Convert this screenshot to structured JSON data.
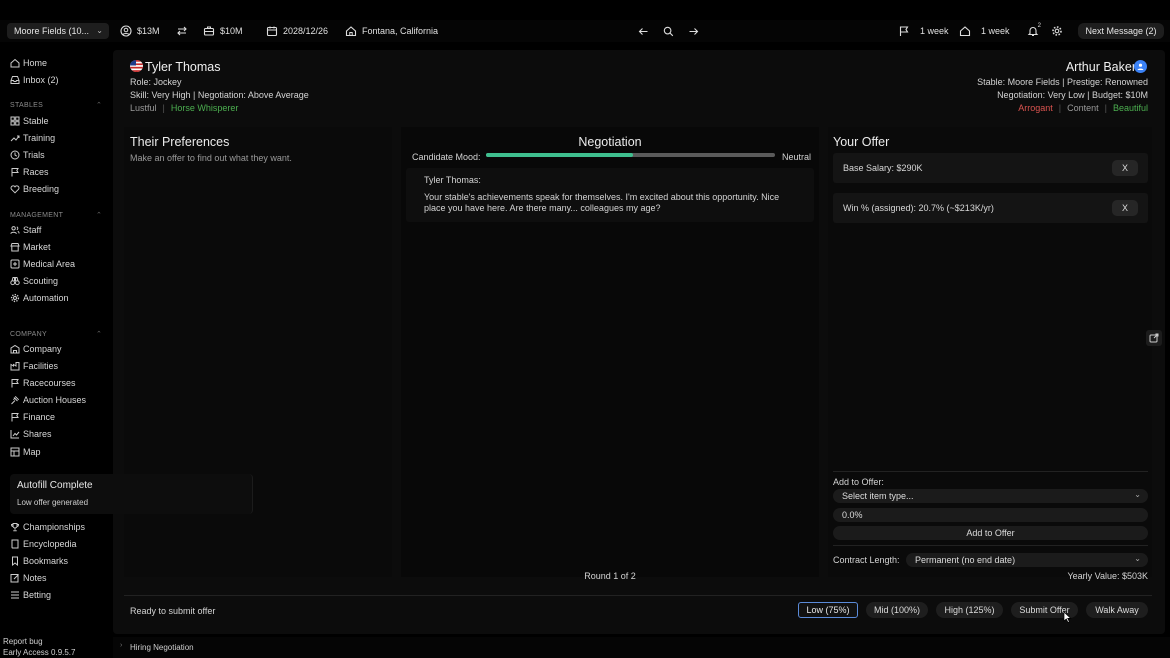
{
  "topbar": {
    "stable_select": "Moore Fields (10...",
    "cash": "$13M",
    "budget": "$10M",
    "date": "2028/12/26",
    "location": "Fontana, California",
    "flag_timer": "1 week",
    "home_timer": "1 week",
    "notif_count": "2",
    "next_message": "Next Message (2)"
  },
  "sidebar": {
    "top": [
      {
        "label": "Home",
        "icon": "home-icon"
      },
      {
        "label": "Inbox (2)",
        "icon": "inbox-icon"
      }
    ],
    "sections": [
      {
        "title": "STABLES",
        "items": [
          "Stable",
          "Training",
          "Trials",
          "Races",
          "Breeding"
        ]
      },
      {
        "title": "MANAGEMENT",
        "items": [
          "Staff",
          "Market",
          "Medical Area",
          "Scouting",
          "Automation"
        ]
      },
      {
        "title": "COMPANY",
        "items": [
          "Company",
          "Facilities",
          "Racecourses",
          "Auction Houses",
          "Finance",
          "Shares",
          "Map"
        ]
      }
    ],
    "more": [
      "Championships",
      "Encyclopedia",
      "Bookmarks",
      "Notes",
      "Betting"
    ],
    "report_bug": "Report bug",
    "version": "Early Access 0.9.5.7"
  },
  "toast": {
    "title": "Autofill Complete",
    "message": "Low offer generated"
  },
  "candidate": {
    "name": "Tyler Thomas",
    "role": "Role: Jockey",
    "skill": "Skill: Very High | Negotiation: Above Average",
    "traits": [
      "Lustful",
      "Horse Whisperer"
    ],
    "trait_colors": [
      "#9a9a9a",
      "#4caf50"
    ]
  },
  "owner": {
    "name": "Arthur Baker",
    "stable_line": "Stable: Moore Fields | Prestige: Renowned",
    "negotiation_line": "Negotiation: Very Low | Budget: $10M",
    "traits": [
      "Arrogant",
      "Content",
      "Beautiful"
    ],
    "trait_colors": [
      "#d9534f",
      "#9a9a9a",
      "#4caf50"
    ]
  },
  "preferences": {
    "title": "Their Preferences",
    "subtitle": "Make an offer to find out what they want."
  },
  "negotiation": {
    "title": "Negotiation",
    "mood_label": "Candidate Mood:",
    "mood_value": "Neutral",
    "mood_fraction": 0.51,
    "speaker": "Tyler Thomas:",
    "message": "Your stable's achievements speak for themselves. I'm excited about this opportunity. Nice place you have here. Are there many... colleagues my age?",
    "round": "Round 1 of 2"
  },
  "offer": {
    "title": "Your Offer",
    "items": [
      "Base Salary: $290K",
      "Win % (assigned): 20.7% (~$213K/yr)"
    ],
    "remove_label": "X",
    "add_label": "Add to Offer:",
    "item_type_placeholder": "Select item type...",
    "value_field": "0.0%",
    "add_button": "Add to Offer",
    "contract_label": "Contract Length:",
    "contract_value": "Permanent (no end date)",
    "yearly_value": "Yearly Value: $503K"
  },
  "footer": {
    "status": "Ready to submit offer",
    "buttons": [
      "Low (75%)",
      "Mid (100%)",
      "High (125%)",
      "Submit Offer",
      "Walk Away"
    ]
  },
  "bottombar": {
    "tab": "Hiring Negotiation"
  }
}
